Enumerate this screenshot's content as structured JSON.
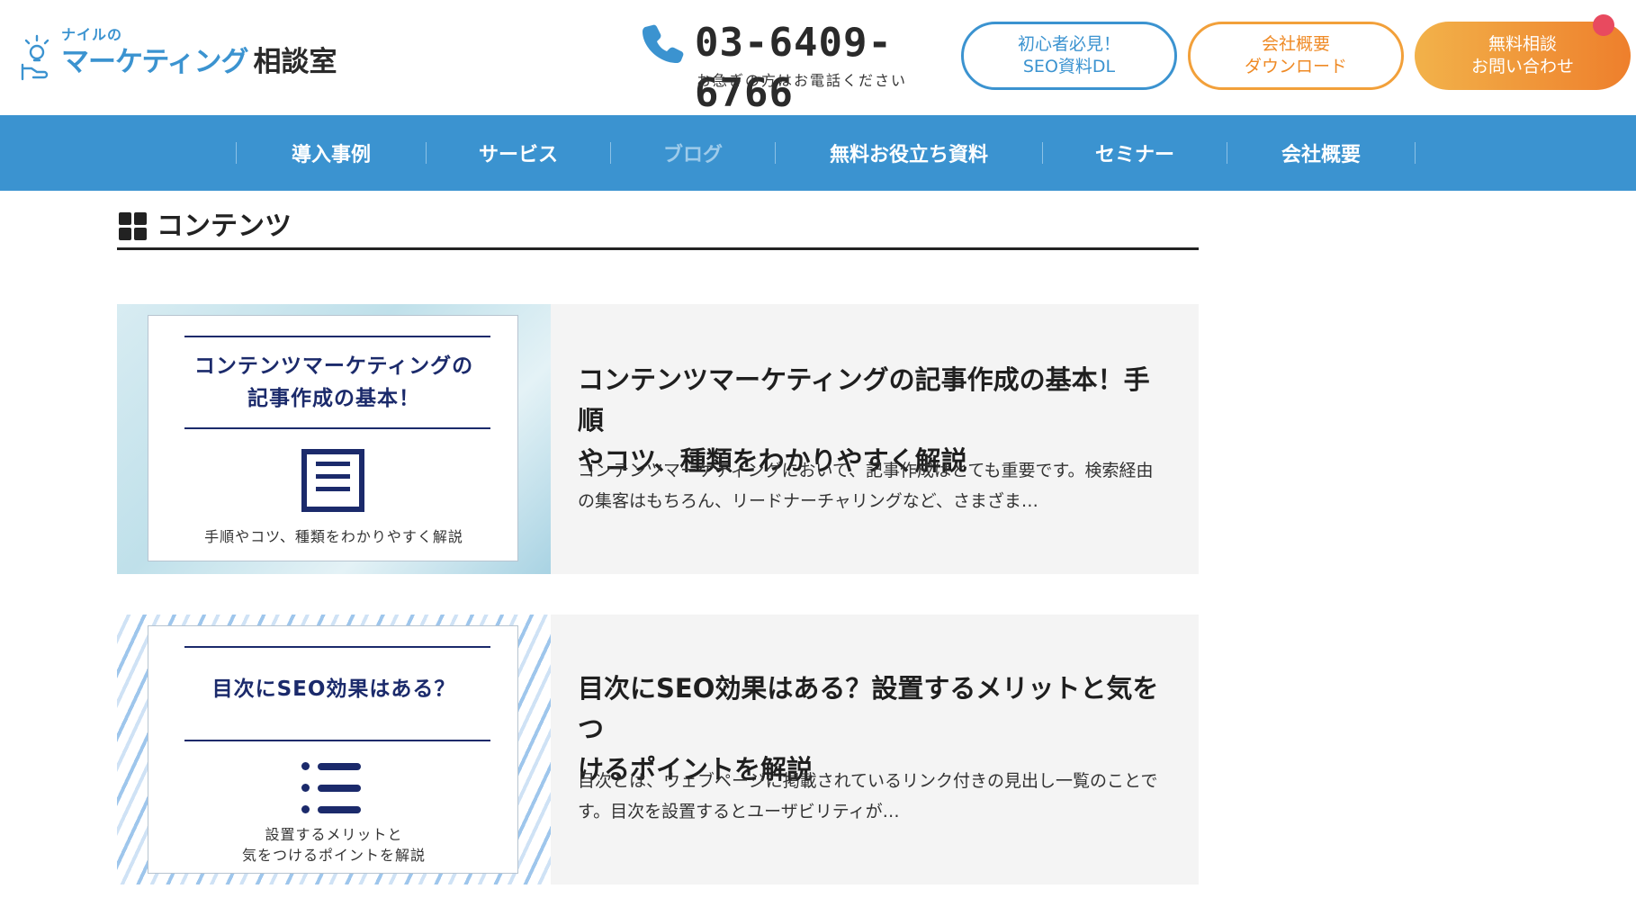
{
  "header": {
    "logo": {
      "small": "ナイルの",
      "blue": "マーケティング",
      "dark": "相談室"
    },
    "phone": {
      "number": "03-6409-6766",
      "note": "お急ぎの方はお電話ください"
    },
    "buttons": {
      "seo_line1": "初心者必見！",
      "seo_line2": "SEO資料DL",
      "company_line1": "会社概要",
      "company_line2": "ダウンロード",
      "contact_line1": "無料相談",
      "contact_line2": "お問い合わせ"
    }
  },
  "nav": {
    "items": [
      "導入事例",
      "サービス",
      "ブログ",
      "無料お役立ち資料",
      "セミナー",
      "会社概要"
    ]
  },
  "section": {
    "title": "コンテンツ"
  },
  "articles": [
    {
      "thumb_title_line1": "コンテンツマーケティングの",
      "thumb_title_line2": "記事作成の基本！",
      "thumb_subtitle": "手順やコツ、種類をわかりやすく解説",
      "title_line1": "コンテンツマーケティングの記事作成の基本！手順",
      "title_line2": "やコツ、種類をわかりやすく解説",
      "excerpt_line1": "コンテンツマーケティングにおいて、記事作成はとても重要です。検索経由",
      "excerpt_line2": "の集客はもちろん、リードナーチャリングなど、さまざま…"
    },
    {
      "thumb_title_line1": "目次にSEO効果はある？",
      "thumb_subtitle_line1": "設置するメリットと",
      "thumb_subtitle_line2": "気をつけるポイントを解説",
      "title_line1": "目次にSEO効果はある？設置するメリットと気をつ",
      "title_line2": "けるポイントを解説",
      "excerpt_line1": "目次とは、ウェブページに掲載されているリンク付きの見出し一覧のことで",
      "excerpt_line2": "す。目次を設置するとユーザビリティが…"
    }
  ],
  "colors": {
    "brand_blue": "#3b93d0",
    "orange": "#ef8a25",
    "navy": "#1b2a6b",
    "notification": "#e84a5f"
  },
  "icons": [
    "lightbulb-hand-icon",
    "phone-icon",
    "grid-icon",
    "document-icon",
    "list-icon"
  ]
}
